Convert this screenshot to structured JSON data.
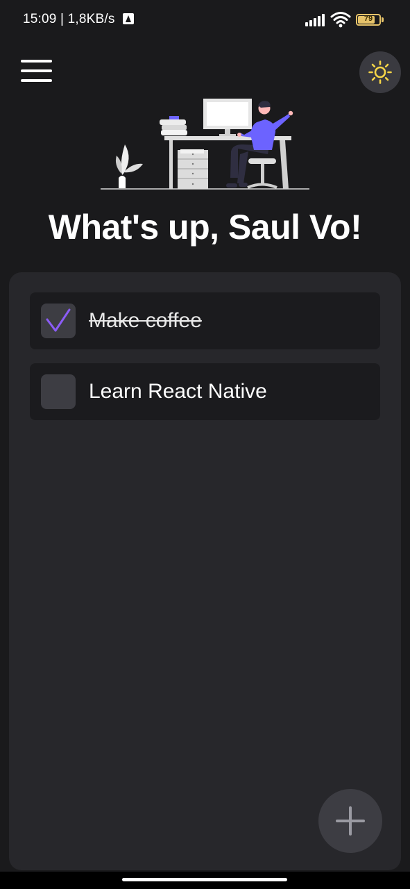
{
  "status_bar": {
    "time_speed": "15:09 | 1,8KB/s",
    "battery_level": "79",
    "battery_fraction": 0.79,
    "icons": [
      "notification-icon",
      "signal-icon",
      "wifi-icon",
      "battery-icon"
    ]
  },
  "header": {
    "menu_icon": "hamburger-menu-icon",
    "theme_icon": "sun-icon",
    "accent_color": "#f5d547"
  },
  "greeting": "What's up, Saul Vo!",
  "tasks": [
    {
      "label": "Make coffee",
      "done": true
    },
    {
      "label": "Learn React Native",
      "done": false
    }
  ],
  "colors": {
    "background": "#1a1a1c",
    "panel": "#27272b",
    "task_item": "#1b1b1e",
    "checkbox": "#3d3d43",
    "checkmark": "#8b5cf6",
    "illustration_accent": "#6c63ff"
  },
  "add_button_icon": "plus-icon"
}
